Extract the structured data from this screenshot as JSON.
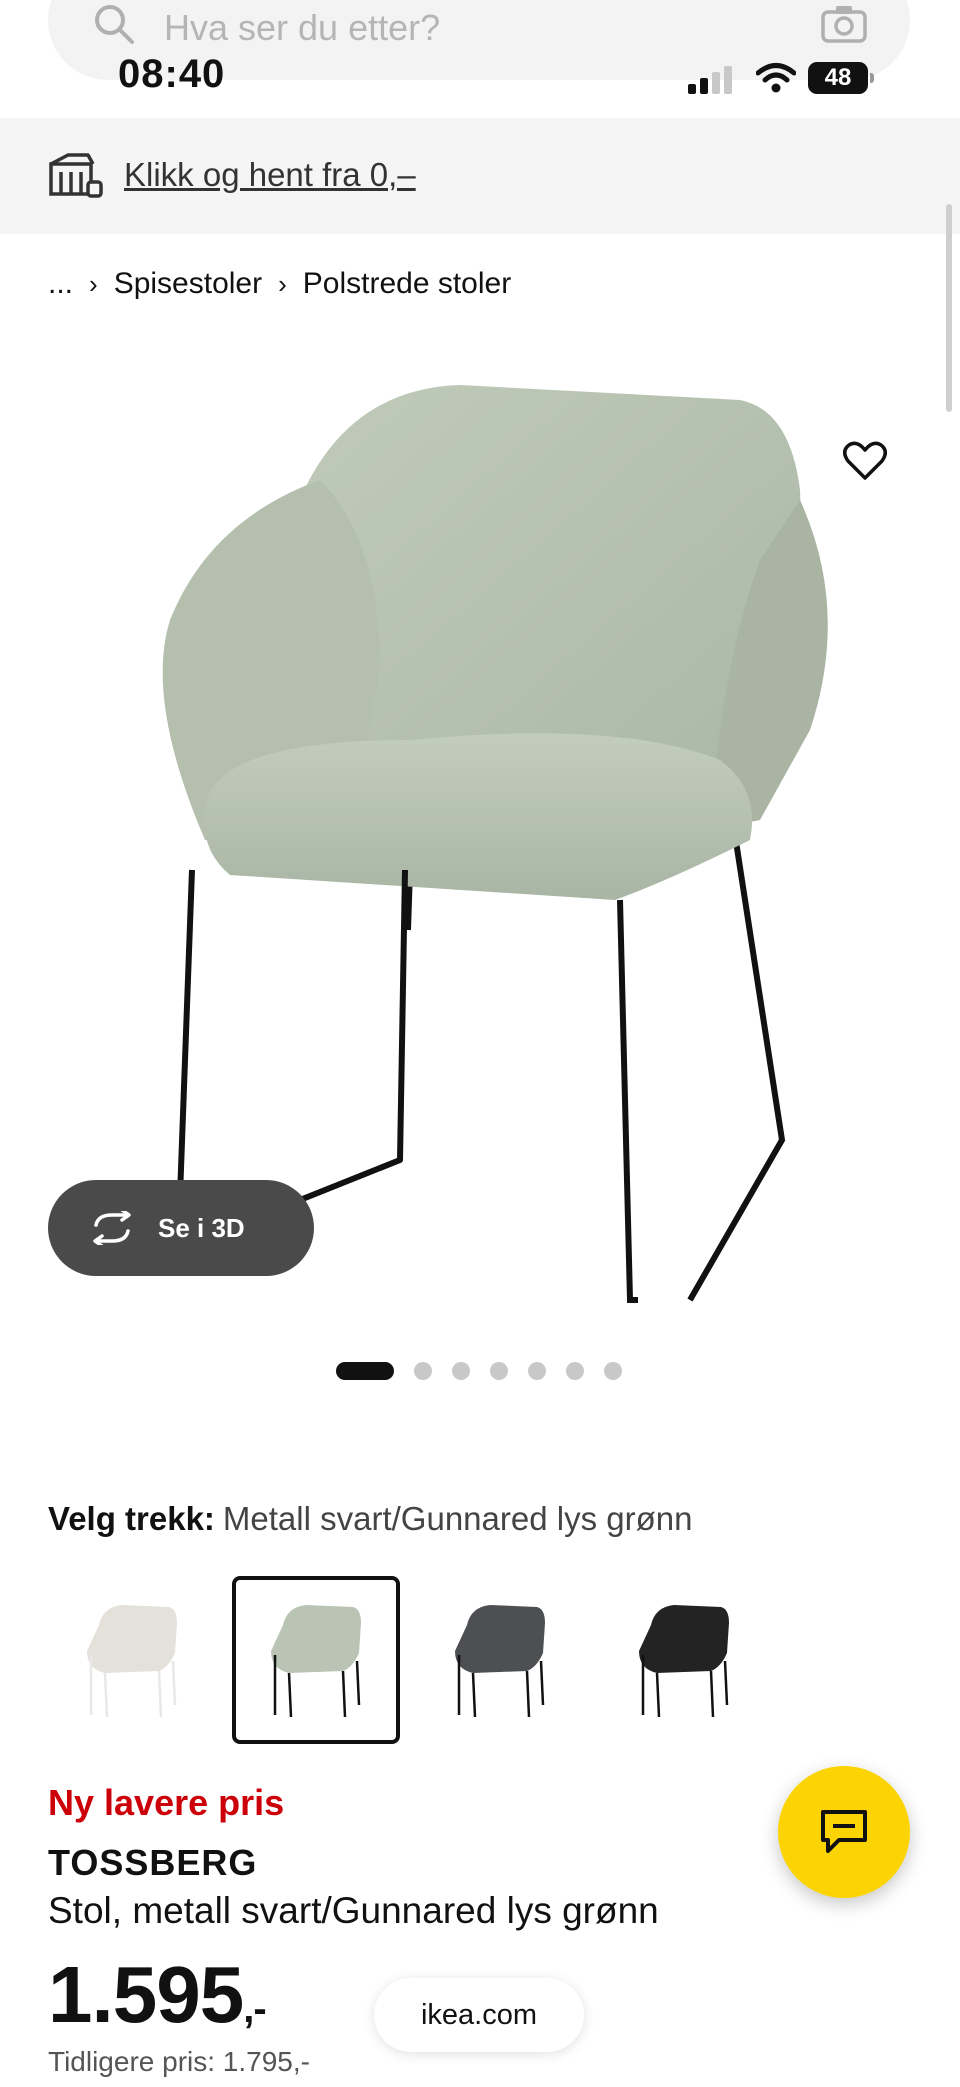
{
  "search": {
    "placeholder": "Hva ser du etter?"
  },
  "status_bar": {
    "time": "08:40",
    "battery": "48"
  },
  "banner": {
    "text": "Klikk og hent fra 0,–"
  },
  "breadcrumb": {
    "ellipsis": "...",
    "items": [
      "Spisestoler",
      "Polstrede stoler"
    ]
  },
  "gallery": {
    "view_3d_label": "Se i 3D",
    "slide_count": 7,
    "active_slide": 1
  },
  "variant": {
    "label": "Velg trekk:",
    "value": "Metall svart/Gunnared lys grønn",
    "options": [
      {
        "color": "#e4e1da",
        "leg": "#f2f2f2"
      },
      {
        "color": "#b9c4b4",
        "leg": "#111111",
        "selected": true
      },
      {
        "color": "#4d4f52",
        "leg": "#111111"
      },
      {
        "color": "#232323",
        "leg": "#111111"
      }
    ]
  },
  "product": {
    "promo": "Ny lavere pris",
    "name": "TOSSBERG",
    "description": "Stol, metall svart/Gunnared lys grønn",
    "price": "1.595",
    "price_suffix": ",-",
    "previous_price": "Tidligere pris: 1.795,-"
  },
  "browser": {
    "url": "ikea.com"
  },
  "colors": {
    "accent_yellow": "#fcd403",
    "promo_red": "#cc0008",
    "chair_fabric": "#b9c4b4"
  }
}
